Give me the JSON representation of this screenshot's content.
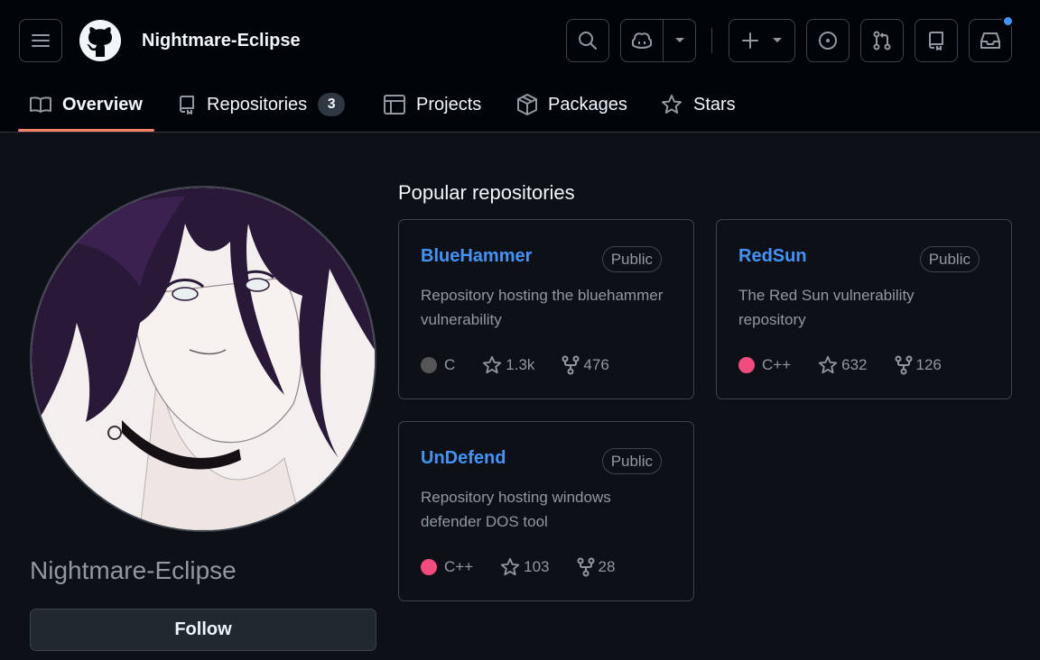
{
  "header": {
    "owner": "Nightmare-Eclipse",
    "icons": [
      "menu-icon",
      "github-logo",
      "search-icon",
      "copilot-icon",
      "chevron-down-icon",
      "plus-icon",
      "issue-icon",
      "pull-request-icon",
      "repo-icon",
      "inbox-icon"
    ],
    "notification_dot_color": "#4493f8"
  },
  "tabs": [
    {
      "label": "Overview",
      "icon": "book-icon",
      "active": true
    },
    {
      "label": "Repositories",
      "icon": "repo-icon",
      "count": "3"
    },
    {
      "label": "Projects",
      "icon": "table-icon"
    },
    {
      "label": "Packages",
      "icon": "package-icon"
    },
    {
      "label": "Stars",
      "icon": "star-icon"
    }
  ],
  "profile": {
    "name": "Nightmare-Eclipse",
    "follow_label": "Follow"
  },
  "popular": {
    "title": "Popular repositories",
    "repos": [
      {
        "name": "BlueHammer",
        "visibility": "Public",
        "description": "Repository hosting the bluehammer vulnerability",
        "language": "C",
        "language_color": "#555555",
        "stars": "1.3k",
        "forks": "476"
      },
      {
        "name": "RedSun",
        "visibility": "Public",
        "description": "The Red Sun vulnerability repository",
        "language": "C++",
        "language_color": "#f34b7d",
        "stars": "632",
        "forks": "126"
      },
      {
        "name": "UnDefend",
        "visibility": "Public",
        "description": "Repository hosting windows defender DOS tool",
        "language": "C++",
        "language_color": "#f34b7d",
        "stars": "103",
        "forks": "28"
      }
    ]
  },
  "colors": {
    "accent": "#f78166",
    "link": "#4493f8",
    "background": "#0d1117",
    "header_background": "#010409"
  }
}
